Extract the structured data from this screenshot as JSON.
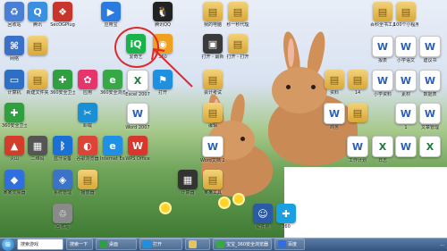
{
  "desktop": {
    "icons": [
      {
        "label": "回收站",
        "color": "#4a7fd6",
        "glyph": "♻"
      },
      {
        "label": "腾讯",
        "color": "#3b8fe0",
        "glyph": "Q"
      },
      {
        "label": "SecOGPlug",
        "color": "#c8352c",
        "glyph": "❖"
      },
      {
        "label": "应用宝",
        "color": "#2a7be0",
        "glyph": "▶"
      },
      {
        "label": "腾讯QQ",
        "color": "#222222",
        "glyph": "🐧"
      },
      {
        "label": "我的电脑",
        "color": "#e8c25a",
        "glyph": "▤"
      },
      {
        "label": "秒一秒代理",
        "color": "#e8c25a",
        "glyph": "▤"
      },
      {
        "label": "网络",
        "color": "#3a70c8",
        "glyph": "⌘"
      },
      {
        "label": "",
        "color": "#e8c25a",
        "glyph": "▤"
      },
      {
        "label": "爱奇艺",
        "color": "#19b34a",
        "glyph": "iQ"
      },
      {
        "label": "360",
        "color": "#f0a020",
        "glyph": "◉"
      },
      {
        "label": "打开 - 最新",
        "color": "#3a3a3a",
        "glyph": "▣"
      },
      {
        "label": "打开 - 打开",
        "color": "#e8c25a",
        "glyph": "▤"
      },
      {
        "label": "计算机",
        "color": "#2d6fc4",
        "glyph": "▭"
      },
      {
        "label": "新建文件夹",
        "color": "#e8c25a",
        "glyph": "▤"
      },
      {
        "label": "360安全卫士",
        "color": "#2f9f3f",
        "glyph": "✚"
      },
      {
        "label": "应用",
        "color": "#e6356b",
        "glyph": "✿"
      },
      {
        "label": "360安全浏览器",
        "color": "#36a845",
        "glyph": "e"
      },
      {
        "label": "Excel 2007",
        "color": "#1e7a3b",
        "glyph": "X"
      },
      {
        "label": "打开",
        "color": "#1f8fe0",
        "glyph": "⚑"
      },
      {
        "label": "会计考试",
        "color": "#e8c25a",
        "glyph": "▤"
      },
      {
        "label": "360安全卫士 Application",
        "color": "#2f9f3f",
        "glyph": "✚"
      },
      {
        "label": "卸载",
        "color": "#1a8fd4",
        "glyph": "✂"
      },
      {
        "label": "Word 2007",
        "color": "#2b5fb8",
        "glyph": "W"
      },
      {
        "label": "编辑",
        "color": "#e8c25a",
        "glyph": "▤"
      },
      {
        "label": "火山",
        "color": "#d23c2b",
        "glyph": "▲"
      },
      {
        "label": "二维码",
        "color": "#555555",
        "glyph": "▦"
      },
      {
        "label": "蓝牙设备",
        "color": "#1a70d6",
        "glyph": "ᛒ"
      },
      {
        "label": "谷歌浏览器",
        "color": "#dc4437",
        "glyph": "◐"
      },
      {
        "label": "Internet Explorer",
        "color": "#1e90e6",
        "glyph": "e"
      },
      {
        "label": "WPS Office",
        "color": "#d7372d",
        "glyph": "W"
      },
      {
        "label": "Word文档 2007",
        "color": "#2b5fb8",
        "glyph": "W"
      },
      {
        "label": "某某交易器",
        "color": "#2f6fe0",
        "glyph": "◆"
      },
      {
        "label": "系统管理",
        "color": "#3b74c6",
        "glyph": "◈"
      },
      {
        "label": "播放器",
        "color": "#e8c25a",
        "glyph": "▤"
      },
      {
        "label": "计算器",
        "color": "#333333",
        "glyph": "▦"
      },
      {
        "label": "某某工具",
        "color": "#ffffff",
        "glyph": "▤"
      },
      {
        "label": "证件照",
        "color": "#2a5aa8",
        "glyph": "☺"
      },
      {
        "label": "360",
        "color": "#1a9fe0",
        "glyph": "✚"
      },
      {
        "label": "回收站",
        "color": "#8a8a8a",
        "glyph": "♲"
      }
    ],
    "right_icons": [
      {
        "label": "百科全书工具",
        "color": "#e8c25a",
        "glyph": "▤"
      },
      {
        "label": "100个小程序",
        "color": "#e8c25a",
        "glyph": "▤"
      },
      {
        "label": "报表",
        "color": "#2b5fb8",
        "glyph": "W"
      },
      {
        "label": "小学语文",
        "color": "#2b5fb8",
        "glyph": "W"
      },
      {
        "label": "建议书",
        "color": "#2b5fb8",
        "glyph": "W"
      },
      {
        "label": "小学资料",
        "color": "#2b5fb8",
        "glyph": "W"
      },
      {
        "label": "素材",
        "color": "#2b5fb8",
        "glyph": "W"
      },
      {
        "label": "资料",
        "color": "#e8c25a",
        "glyph": "▤"
      },
      {
        "label": "14",
        "color": "#e8c25a",
        "glyph": "▤"
      },
      {
        "label": "数据表",
        "color": "#2b5fb8",
        "glyph": "W"
      },
      {
        "label": "商务",
        "color": "#2b5fb8",
        "glyph": "W"
      },
      {
        "label": "",
        "color": "#e8c25a",
        "glyph": "▤"
      },
      {
        "label": "1",
        "color": "#2b5fb8",
        "glyph": "W"
      },
      {
        "label": "文章管理",
        "color": "#2b5fb8",
        "glyph": "W"
      },
      {
        "label": "工作计划",
        "color": "#2b5fb8",
        "glyph": "W"
      },
      {
        "label": "日志",
        "color": "#1e7a3b",
        "glyph": "X"
      },
      {
        "label": "",
        "color": "#2b5fb8",
        "glyph": "W"
      },
      {
        "label": "",
        "color": "#1e7a3b",
        "glyph": "X"
      }
    ]
  },
  "taskbar": {
    "search_text": "搜索游戏",
    "search_btn": "搜索一下",
    "items": [
      "桌面",
      "打开",
      "",
      "宝宝_360安全浏览器",
      "百度"
    ],
    "tray_time": "..."
  },
  "colors": {
    "annotation": "#e02a2a",
    "taskbar": "#34557f"
  }
}
